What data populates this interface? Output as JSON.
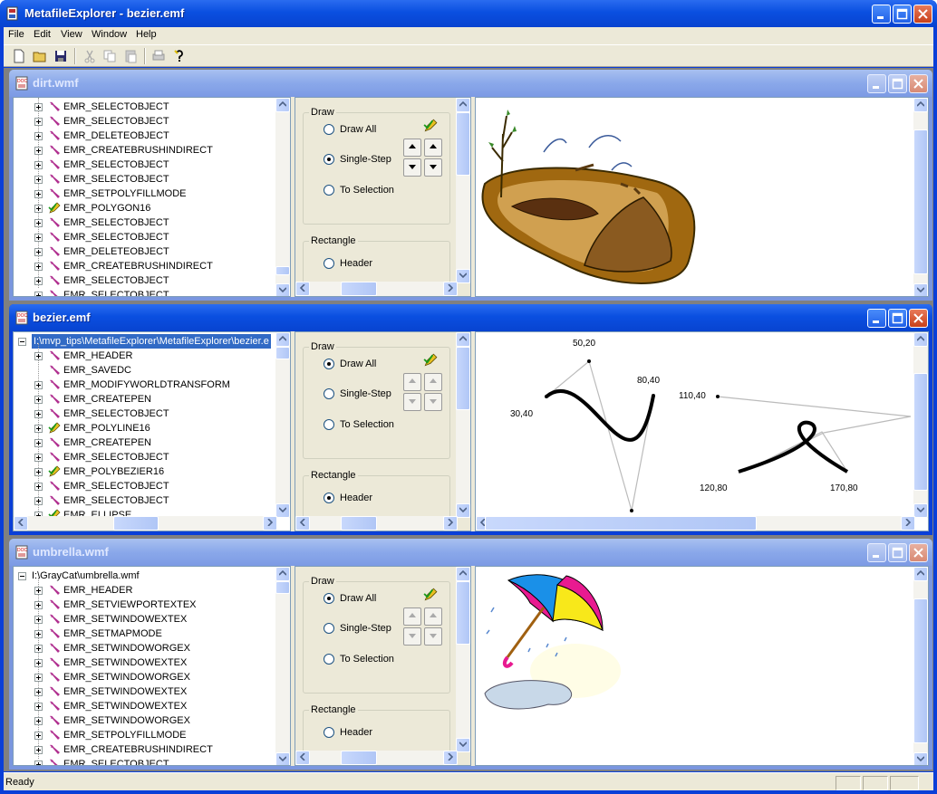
{
  "app": {
    "title": "MetafileExplorer - bezier.emf"
  },
  "menu": [
    "File",
    "Edit",
    "View",
    "Window",
    "Help"
  ],
  "status": {
    "text": "Ready"
  },
  "ctrl": {
    "draw_group": "Draw",
    "draw_all": "Draw All",
    "single_step": "Single-Step",
    "to_selection": "To Selection",
    "rect_group": "Rectangle",
    "header": "Header"
  },
  "windows": [
    {
      "title": "dirt.wmf",
      "root": "",
      "draw_mode": "single",
      "rect_mode": "none",
      "rows": [
        "EMR_SELECTOBJECT",
        "EMR_SELECTOBJECT",
        "EMR_DELETEOBJECT",
        "EMR_CREATEBRUSHINDIRECT",
        "EMR_SELECTOBJECT",
        "EMR_SELECTOBJECT",
        "EMR_SETPOLYFILLMODE",
        "EMR_POLYGON16",
        "EMR_SELECTOBJECT",
        "EMR_SELECTOBJECT",
        "EMR_DELETEOBJECT",
        "EMR_CREATEBRUSHINDIRECT",
        "EMR_SELECTOBJECT",
        "EMR_SELECTOBJECT"
      ],
      "draw_rows": [
        7
      ]
    },
    {
      "title": "bezier.emf",
      "root": "I:\\mvp_tips\\MetafileExplorer\\MetafileExplorer\\bezier.e",
      "draw_mode": "all",
      "rect_mode": "header",
      "rows": [
        "EMR_HEADER",
        "EMR_SAVEDC",
        "EMR_MODIFYWORLDTRANSFORM",
        "EMR_CREATEPEN",
        "EMR_SELECTOBJECT",
        "EMR_POLYLINE16",
        "EMR_CREATEPEN",
        "EMR_SELECTOBJECT",
        "EMR_POLYBEZIER16",
        "EMR_SELECTOBJECT",
        "EMR_SELECTOBJECT",
        "EMR_ELLIPSE"
      ],
      "draw_rows": [
        5,
        8,
        11
      ],
      "labels": [
        "50,20",
        "80,40",
        "30,40",
        "110,40",
        "120,80",
        "170,80"
      ]
    },
    {
      "title": "umbrella.wmf",
      "root": "I:\\GrayCat\\umbrella.wmf",
      "draw_mode": "all",
      "rect_mode": "none",
      "rows": [
        "EMR_HEADER",
        "EMR_SETVIEWPORTEXTEX",
        "EMR_SETWINDOWEXTEX",
        "EMR_SETMAPMODE",
        "EMR_SETWINDOWORGEX",
        "EMR_SETWINDOWEXTEX",
        "EMR_SETWINDOWORGEX",
        "EMR_SETWINDOWEXTEX",
        "EMR_SETWINDOWEXTEX",
        "EMR_SETWINDOWORGEX",
        "EMR_SETPOLYFILLMODE",
        "EMR_CREATEBRUSHINDIRECT",
        "EMR_SELECTOBJECT"
      ],
      "draw_rows": []
    }
  ]
}
